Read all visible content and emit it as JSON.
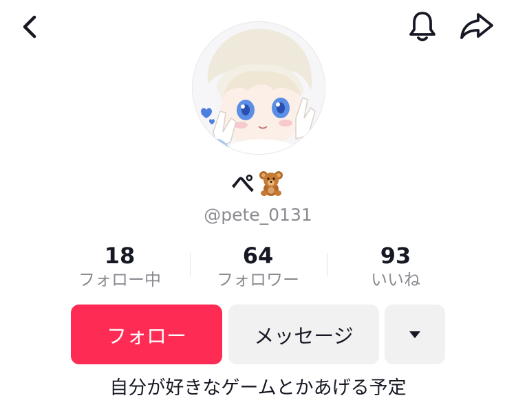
{
  "header": {
    "back_icon": "chevron-left-icon",
    "bell_icon": "bell-icon",
    "share_icon": "share-arrow-icon"
  },
  "profile": {
    "display_name": "ぺ",
    "display_name_emoji": "teddy-bear-emoji",
    "handle": "@pete_0131",
    "bio": "自分が好きなゲームとかあげる予定"
  },
  "stats": [
    {
      "value": "18",
      "label": "フォロー中"
    },
    {
      "value": "64",
      "label": "フォロワー"
    },
    {
      "value": "93",
      "label": "いいね"
    }
  ],
  "actions": {
    "follow_label": "フォロー",
    "message_label": "メッセージ",
    "more_icon": "caret-down-icon"
  },
  "colors": {
    "accent": "#fe2c55",
    "secondary_button": "#f1f1f2",
    "text_primary": "#161823",
    "text_secondary": "#8a8b91"
  }
}
